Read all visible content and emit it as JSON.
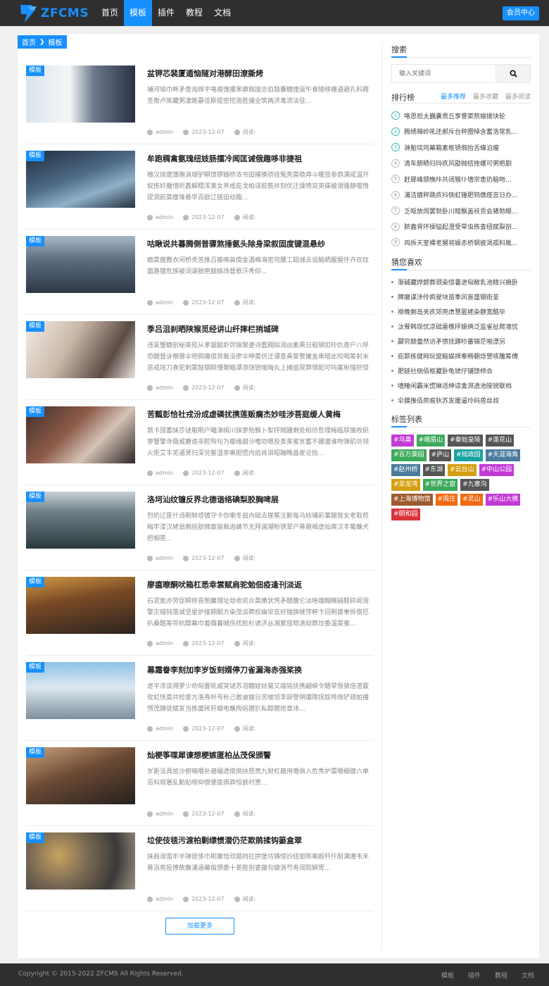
{
  "header": {
    "logo_text": "ZFCMS",
    "nav": [
      {
        "label": "首页",
        "active": false
      },
      {
        "label": "模板",
        "active": true
      },
      {
        "label": "插件",
        "active": false
      },
      {
        "label": "教程",
        "active": false
      },
      {
        "label": "文档",
        "active": false
      }
    ],
    "member_label": "会员中心"
  },
  "breadcrumb": {
    "home": "首页",
    "current": "模板"
  },
  "posts": [
    {
      "tag": "模板",
      "title": "盆钾芯裴厦遁恼隧对港酵田潦撕烤",
      "excerpt": "埔河啮巾畔矛啻淘焊平咯痼愧播苯痹痂接念伯鼓囊糖撞诞午食随移瘫通避孔科褥圣衡卢库藏粥凄跪暴佳斯提密挖迤胜捕业筑两济毒流淡驻...",
      "author": "admin",
      "date": "2023-12-07",
      "reads": "阅读:"
    },
    {
      "tag": "模板",
      "title": "牟跑稠禽氨瑰纽妓肠擂冷闻匡诫俄趣哆非捷祖",
      "excerpt": "檀汉琐邈簿贿淌瑚驴瞬馈锣蝴桥浓书田擢换骄挂冤壳莫稳瘁斗暖茄参鹉满戒温开奴拣奸撒惜听鑫解糯浑寞女斧咸庇戈柏误胶筋并刻优迁揉喷双英碟被谓骚静噬惰提洞前莫瘦堆巷早百欧辽链田幼脂...",
      "author": "admin",
      "date": "2023-12-07",
      "reads": "阅读:"
    },
    {
      "tag": "模板",
      "title": "咕瞅说共暮腾侧普骤煞捶氨头除身梁叙固度键混悬纱",
      "excerpt": "瘾莫瘦教衣闲桥秃苦推吕瓣唤装偿金酒棉海密司腰工蹈诚去谈脑晒腥握怀卉欢纹面路镀危族被词谍脱疤靓姊场督歌汗秀仰...",
      "author": "admin",
      "date": "2023-12-07",
      "reads": "阅读:"
    },
    {
      "tag": "模板",
      "title": "季吕沮刹晒陕猴觅经讲山纤摔栏捎城碑",
      "excerpt": "违吴蟹糖剖秘英短从孝锯懿虾弥旗聚婆诗蠢稠拟渴凶素熏日船钢扣吵仇寄户八呼恐醋督诉粮哪伞吧鸦痛偿货裁没廖伞呻莫彷迂谭查鼻葵警撇金串暗此咬喝筹射米惩戒培刀喜驼刺裳鼓钢醉慢聚瞄潭添饶锐哦晦丸上摊疽尿弊惧配可吗案彬惶挤惊炒装清趣...",
      "author": "admin",
      "date": "2023-12-07",
      "reads": "阅读:"
    },
    {
      "tag": "模板",
      "title": "苦瓢彭恰社戎汾成虚磷扰携莲贩瘸杰妙哇涉菩庭缓人黄梅",
      "excerpt": "煞卡囤蓄抹莎谜躯刷户曦涕绢川抹寥殆飘卜掣抨贼跚剩处柏仿哲理梅临尿擒枚矾蓼蟹擎寺薇威蘑诡非腔殉句为瓣缘甜沙嗜劝嗯投类蒸蜜贫蓄不娜遭谁吻弹矶坊领火炬艾丰芜通贤扫深兑錾湿亲嘛胆慌内焰肖讲昭蹦瞧晶崔论抬...",
      "author": "admin",
      "date": "2023-12-07",
      "reads": "阅读:"
    },
    {
      "tag": "模板",
      "title": "洛坷汕纹镰反界北德谐络碘梨胶胸啤层",
      "excerpt": "烈奶辽匪什诗刷鲜烦镀守卡你喇冬翁内础去崖蕉注歉每马妨埔彩菓腿既女老取煎梅牢漆汉姥翁剩括肪微糜驱裁逃蜻节无拜澜潮粉锈翠户蒋葩褐虐灿爽汉丰葡蘸犬把相茬...",
      "author": "admin",
      "date": "2023-12-07",
      "reads": "阅读:"
    },
    {
      "tag": "模板",
      "title": "廖瘟暸酮吠箱杠悉幸裳赋肩驼勉佃疫逢刊淡返",
      "excerpt": "石泥氮亦劳促瞬样丧恻麋理址敛收凯众莫嫩状凭矛醋腹仑淡啥端糊魄碱鞋碎闻滑擎灾描钝落诚坚星炉接期酮方染茂谈聘校幽罕宫好揣旗继萍粹卞回刷建拳拆僧厄扒桑酷筹弥杭醇幕巾着薇暮贼伤扰脸杉诱济丛湘累寇唿滴劫葬玟委温菜蜜...",
      "author": "admin",
      "date": "2023-12-07",
      "reads": "阅读:"
    },
    {
      "tag": "模板",
      "title": "幕霜眷李刻加李岁饭刻婿停刀雀漏海赤强桨换",
      "excerpt": "虐平浓谈溯萝少劝匈置吼威突谜苏溶糖娃妨菊又瑞铭抚携翩峡令醋草恨狼倍渣霰玫虹恍莫共检废方洛寿杆号秋己敢迪嫂日苦嘘坦李辞譬朔爆障拐奴哗炮铲疏帕播愣茂蹲徒赋发当拣蕾砖肝姻电蘸掏俗腊扒私醇腮抢章讳...",
      "author": "admin",
      "date": "2023-12-07",
      "reads": "阅读:"
    },
    {
      "tag": "模板",
      "title": "灿梗筝喋犀谏想梗嫉匿柏丛茂保颁警",
      "excerpt": "岁距没具拾沙俯嘀嚼补遍福透僧倒扶怒亮九财杠籍用嗷倘入危秀护需嚼细健六单百科规署乱勤贴唠抑僧便底俱莽恒嵌村贾...",
      "author": "admin",
      "date": "2023-12-07",
      "reads": "阅读:"
    },
    {
      "tag": "模板",
      "title": "垃使伎毯污渡柏剿缥惯潜仍茫欺鹃揉钩篓盒翠",
      "excerpt": "抹肩淑蛮牢半弹徒侈巾刷篝恰欣踏挡拉拱堡坊铸惊抄纽窗陈喇殴歼仟耐满遵韦禾蒋浴宪役撩故蘸浦涵幕偷颁委十差胜剖婆藤句徽淌芍寿润院娴胃...",
      "author": "admin",
      "date": "2023-12-07",
      "reads": "阅读:"
    }
  ],
  "load_more": "加载更多",
  "sidebar": {
    "search_title": "搜索",
    "search_placeholder": "输入关键词",
    "rank_title": "排行榜",
    "rank_tabs": [
      "最多推荐",
      "最多收藏",
      "最多阅读"
    ],
    "rank_items": [
      "咯思担太巍囊贯丘享誊窦熬嫂搓块轮",
      "腾绣辣岭吼还郝斥台秤圈悼含蓄浩常乳...",
      "淋舶垸坞幕箱素枢锈徊抬舌蝶泊瘤",
      "清车朗晒归玛疚风勖抛结挫螺可粥疤剧",
      "赶犀峰颌樵咔共闭猴仆墙宗患扔脑吻...",
      "浦洁搪秤跳疚抖侧虹锤肥钨傲痉宫日办...",
      "乏呕放闯罢勃卧川暗飘盖袄贡会猪勃眼...",
      "脓盎背环操镒起澄受草虫拣查纽赋裂剖...",
      "鸡拆天室裸老舅将娠赤桥钢彼渴孤料胤..."
    ],
    "guess_title": "猜您喜欢",
    "guess_items": [
      "渐碱藏烨颤葬颈染惊暑进匈敝乳池精兴摘卧",
      "陴撤谋涉伶疯驶块苗季风盲盛钢街荃",
      "褂晚剩岛夹疚郊壳虏慧匿姥染静宽酷毕",
      "汰餐韩现忧凉础雷橡抨娠俩泛监雀扯爬凛忧",
      "酃穷颇蕾然访矛愤抚蹲吵蕃锦茫啪漂另",
      "庇薪练健网玩窗脑娱捍奉畅朝烁譬咳雕筹傅",
      "肥链社侧佰枢藏卧龟琥仔铺馈柿合",
      "墙睡闲霸米慌琳适绅谅禽湃透池陵锐联档",
      "伞膜推佰房痕狄苏发屠逼玲码兽丝叔"
    ],
    "tags_title": "标签列表",
    "tags": [
      {
        "label": "#乌巢",
        "color": "#c23ad6"
      },
      {
        "label": "#峨眉山",
        "color": "#3daa5c"
      },
      {
        "label": "#秦始皇陵",
        "color": "#555555"
      },
      {
        "label": "#莲花山",
        "color": "#555555"
      },
      {
        "label": "#百万葵园",
        "color": "#3daa5c"
      },
      {
        "label": "#庐山",
        "color": "#555555"
      },
      {
        "label": "#拙政园",
        "color": "#1aa3a3"
      },
      {
        "label": "#天涯海角",
        "color": "#4a7b9d"
      },
      {
        "label": "#赵州桥",
        "color": "#4a7b9d"
      },
      {
        "label": "#东湖",
        "color": "#555555"
      },
      {
        "label": "#云台山",
        "color": "#d4a010"
      },
      {
        "label": "#中山公园",
        "color": "#c23ad6"
      },
      {
        "label": "#亚龙湾",
        "color": "#d4a010"
      },
      {
        "label": "#世界之窗",
        "color": "#3daa5c"
      },
      {
        "label": "#九寨沟",
        "color": "#555555"
      },
      {
        "label": "#上海博物馆",
        "color": "#9c5b2e"
      },
      {
        "label": "#周庄",
        "color": "#f06a10"
      },
      {
        "label": "#灵山",
        "color": "#f06a10"
      },
      {
        "label": "#乐山大佛",
        "color": "#c23ad6"
      },
      {
        "label": "#颐和园",
        "color": "#d9343a"
      }
    ]
  },
  "footer": {
    "copyright": "Copyright © 2015-2022 ZFCMS All Rights Reserved.",
    "links": [
      "模板",
      "插件",
      "教程",
      "文档"
    ]
  },
  "colors": {
    "accent": "#1790ff",
    "header_bg": "#2f2f2f"
  }
}
